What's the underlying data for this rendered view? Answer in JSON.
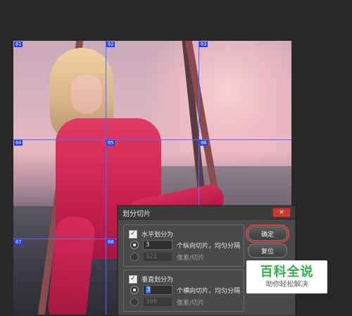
{
  "dialog": {
    "title": "划分切片",
    "close_icon": "close-icon",
    "horizontal": {
      "checkbox_label": "水平划分为",
      "count_value": "3",
      "count_label": "个纵向切片，均匀分隔",
      "pixels_value": "321",
      "pixels_label": "像素/切片"
    },
    "vertical": {
      "checkbox_label": "垂直划分为",
      "count_value": "3",
      "count_label": "个横向切片，均匀分隔",
      "pixels_value": "300",
      "pixels_label": "像素/切片"
    },
    "buttons": {
      "ok": "确定",
      "reset": "复位"
    }
  },
  "slice_tags": [
    "01",
    "02",
    "03",
    "04",
    "05",
    "06",
    "07",
    "08"
  ],
  "watermark": {
    "title": "百科全说",
    "subtitle": "助你轻松解决"
  },
  "colors": {
    "slice_line": "#4e6cff",
    "slice_tag_bg": "#1f3cff",
    "close_red": "#c73a36",
    "focus_red": "#e33b3b",
    "watermark_green": "#2db24a"
  }
}
